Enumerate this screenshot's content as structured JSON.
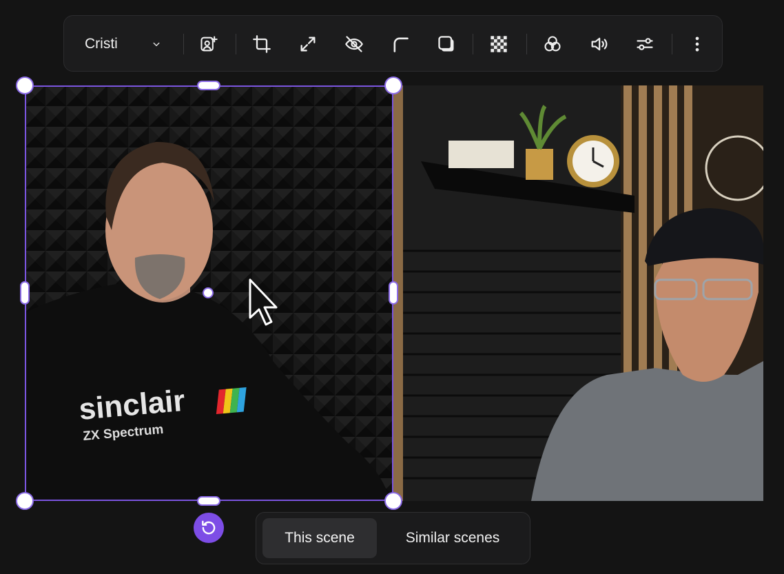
{
  "toolbar": {
    "participant_name": "Cristi",
    "tools": [
      "add-member-icon",
      "crop-icon",
      "expand-icon",
      "eye-off-icon",
      "corner-radius-icon",
      "shadow-icon",
      "transparency-icon",
      "filters-icon",
      "volume-icon",
      "adjustments-icon",
      "more-vertical-icon"
    ]
  },
  "left_video": {
    "shirt_text": "sinclair",
    "shirt_subtext": "ZX Spectrum"
  },
  "scene_tabs": {
    "active": "This scene",
    "other": "Similar scenes"
  },
  "colors": {
    "accent": "#7b55e0",
    "rotate_button": "#7d4de6",
    "background": "#141414"
  }
}
